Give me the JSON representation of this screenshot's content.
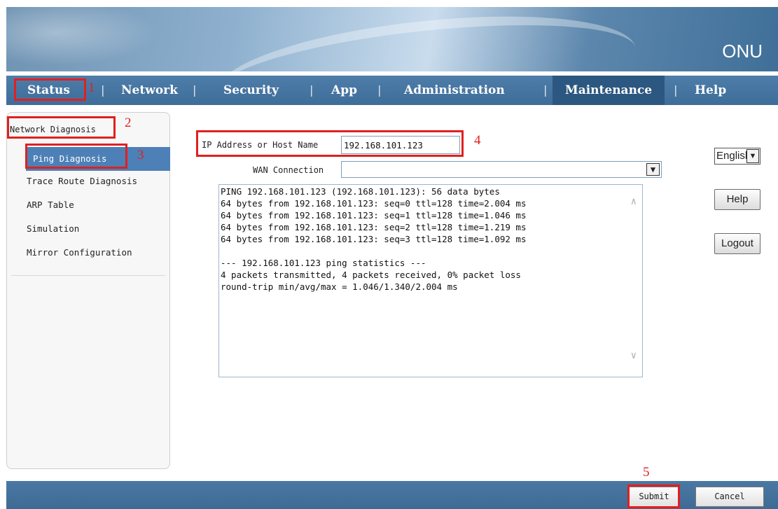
{
  "header": {
    "brand": "ONU"
  },
  "nav": {
    "items": [
      {
        "label": "Status"
      },
      {
        "label": "Network"
      },
      {
        "label": "Security"
      },
      {
        "label": "App"
      },
      {
        "label": "Administration"
      },
      {
        "label": "Maintenance",
        "active": true
      },
      {
        "label": "Help"
      }
    ],
    "separator": "|"
  },
  "sidebar": {
    "title": "Network Diagnosis",
    "items": [
      {
        "label": "Ping Diagnosis",
        "active": true
      },
      {
        "label": "Trace Route Diagnosis"
      },
      {
        "label": "ARP Table"
      },
      {
        "label": "Simulation"
      },
      {
        "label": "Mirror Configuration"
      }
    ]
  },
  "form": {
    "ip_label": "IP Address or Host Name",
    "ip_value": "192.168.101.123",
    "wan_label": "WAN Connection",
    "wan_value": ""
  },
  "output": {
    "lines": [
      "PING 192.168.101.123 (192.168.101.123): 56 data bytes",
      "64 bytes from 192.168.101.123: seq=0 ttl=128 time=2.004 ms",
      "64 bytes from 192.168.101.123: seq=1 ttl=128 time=1.046 ms",
      "64 bytes from 192.168.101.123: seq=2 ttl=128 time=1.219 ms",
      "64 bytes from 192.168.101.123: seq=3 ttl=128 time=1.092 ms",
      "",
      "--- 192.168.101.123 ping statistics ---",
      "4 packets transmitted, 4 packets received, 0% packet loss",
      "round-trip min/avg/max = 1.046/1.340/2.004 ms"
    ]
  },
  "right_panel": {
    "language": "English",
    "help_label": "Help",
    "logout_label": "Logout"
  },
  "footer": {
    "submit_label": "Submit",
    "cancel_label": "Cancel"
  },
  "annotations": {
    "numbers": [
      "1",
      "2",
      "3",
      "4",
      "5"
    ],
    "color": "#e02020"
  },
  "colors": {
    "nav_bg": "#3f6d99",
    "nav_active": "#2c5780",
    "sidebar_active": "#4d80b6"
  }
}
